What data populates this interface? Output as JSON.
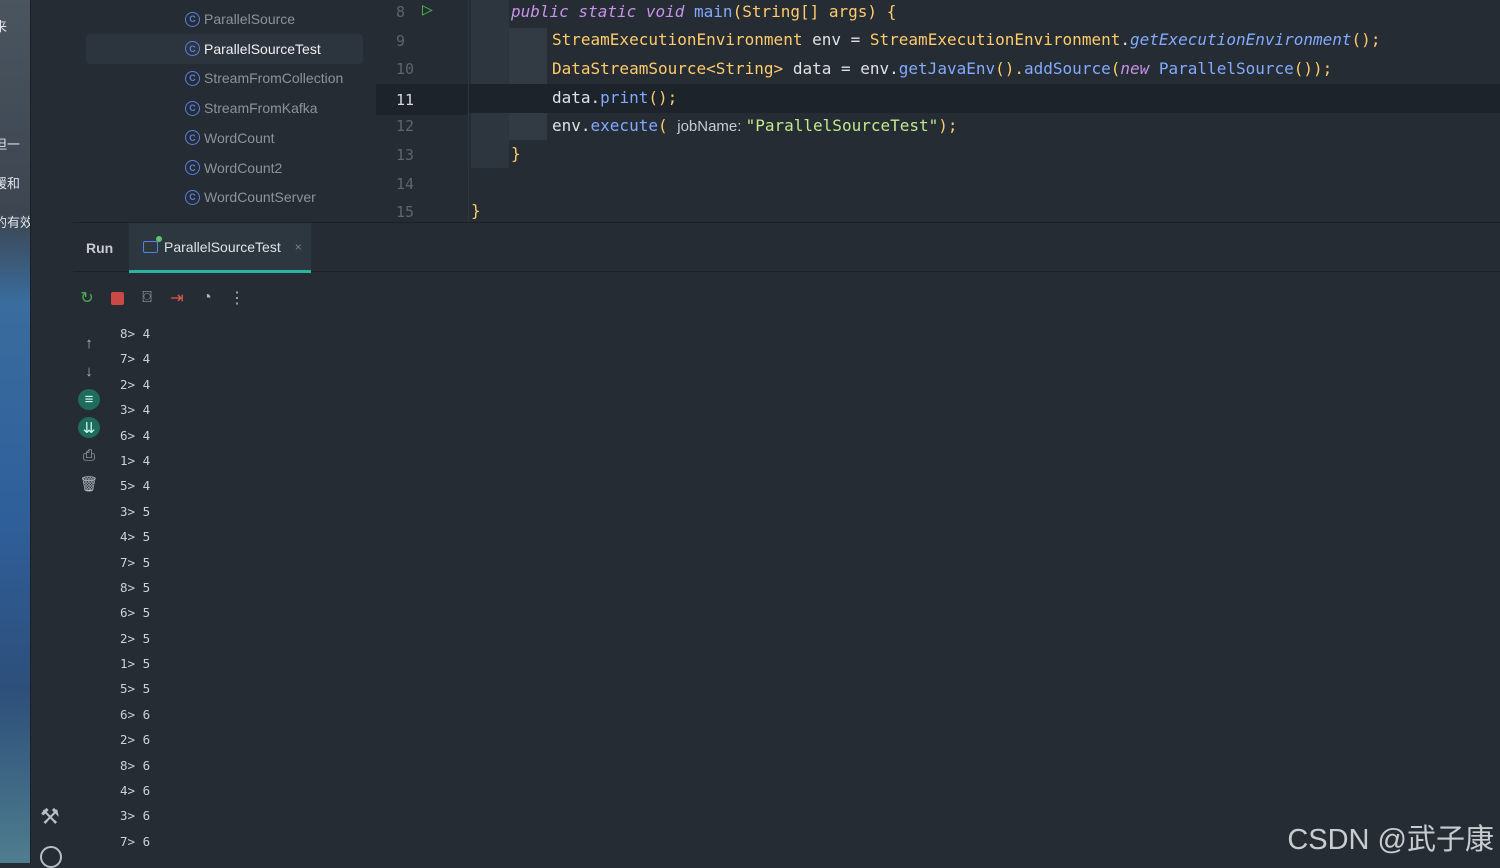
{
  "desktop_fragments": [
    "来",
    "但一",
    "暖和",
    "的有效"
  ],
  "project_tree": {
    "items": [
      {
        "label": "ParallelSource",
        "selected": false
      },
      {
        "label": "ParallelSourceTest",
        "selected": true
      },
      {
        "label": "StreamFromCollection",
        "selected": false
      },
      {
        "label": "StreamFromKafka",
        "selected": false
      },
      {
        "label": "WordCount",
        "selected": false
      },
      {
        "label": "WordCount2",
        "selected": false
      },
      {
        "label": "WordCountServer",
        "selected": false
      }
    ]
  },
  "editor": {
    "line_numbers": [
      "8",
      "9",
      "10",
      "11",
      "12",
      "13",
      "14",
      "15"
    ],
    "current_line": "11",
    "lines": {
      "l8": {
        "kw": "public static void ",
        "fn": "main",
        "rest": "(String[] args) {"
      },
      "l9": {
        "ty": "StreamExecutionEnvironment",
        "a": " env = ",
        "ty2": "StreamExecutionEnvironment",
        "b": ".",
        "fn": "getExecutionEnvironment",
        "c": "();"
      },
      "l10": {
        "ty": "DataStreamSource<String>",
        "a": " data = env.",
        "fn": "getJavaEnv",
        "b": "().",
        "fn2": "addSource",
        "c": "(",
        "kw": "new ",
        "ty2": "ParallelSource",
        "d": "());"
      },
      "l11": {
        "a": "data.",
        "fn": "print",
        "b": "();"
      },
      "l12": {
        "a": "env.",
        "fn": "execute",
        "b": "( ",
        "hint": "jobName: ",
        "st": "\"ParallelSourceTest\"",
        "c": ");"
      },
      "l13": "}",
      "l15": "}"
    }
  },
  "run_panel": {
    "label": "Run",
    "tab": "ParallelSourceTest",
    "close": "×"
  },
  "console": [
    [
      "8>",
      "4"
    ],
    [
      "7>",
      "4"
    ],
    [
      "2>",
      "4"
    ],
    [
      "3>",
      "4"
    ],
    [
      "6>",
      "4"
    ],
    [
      "1>",
      "4"
    ],
    [
      "5>",
      "4"
    ],
    [
      "3>",
      "5"
    ],
    [
      "4>",
      "5"
    ],
    [
      "7>",
      "5"
    ],
    [
      "8>",
      "5"
    ],
    [
      "6>",
      "5"
    ],
    [
      "2>",
      "5"
    ],
    [
      "1>",
      "5"
    ],
    [
      "5>",
      "5"
    ],
    [
      "6>",
      "6"
    ],
    [
      "2>",
      "6"
    ],
    [
      "8>",
      "6"
    ],
    [
      "4>",
      "6"
    ],
    [
      "3>",
      "6"
    ],
    [
      "7>",
      "6"
    ]
  ],
  "watermark": "CSDN @武子康"
}
